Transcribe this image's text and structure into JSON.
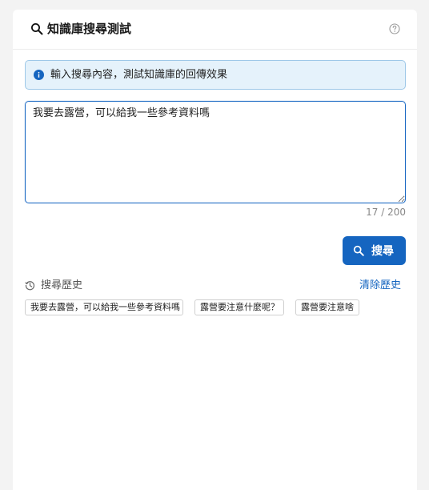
{
  "header": {
    "title": "知識庫搜尋測試",
    "search_icon": "search-icon",
    "help_icon": "help-circle-icon"
  },
  "info": {
    "icon": "info-icon",
    "text": "輸入搜尋內容，測試知識庫的回傳效果"
  },
  "query": {
    "value": "我要去露營，可以給我一些參考資料嗎",
    "char_count": "17 / 200"
  },
  "search_button": {
    "label": "搜尋",
    "icon": "search-icon"
  },
  "history": {
    "icon": "history-icon",
    "title": "搜尋歷史",
    "clear_label": "清除歷史",
    "items": [
      "我要去露營，可以給我一些參考資料嗎",
      "露營要注意什麼呢？",
      "露營要注意啥"
    ]
  },
  "colors": {
    "accent": "#1565c0",
    "info_bg": "#e5f2fb",
    "info_border": "#9ec8e8"
  }
}
